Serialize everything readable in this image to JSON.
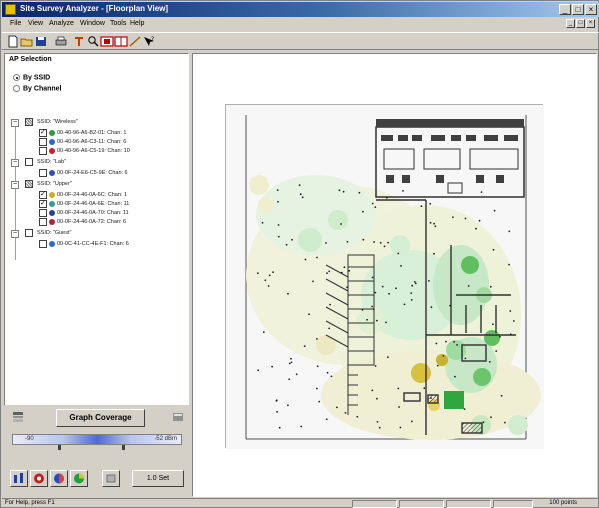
{
  "window": {
    "title": "Site Survey Analyzer - [Floorplan View]",
    "buttons": [
      "_",
      "□",
      "×"
    ]
  },
  "menu": [
    "File",
    "View",
    "Analyze",
    "Window",
    "Tools",
    "Help"
  ],
  "toolbar": [
    "new-icon",
    "open-icon",
    "save-icon",
    "print-icon",
    "filter-icon",
    "zoom-icon",
    "ap-icon",
    "grid-icon",
    "measure-icon",
    "help-icon"
  ],
  "left_panel": {
    "title": "AP Selection",
    "radio_ssid": "By SSID",
    "radio_channel": "By Channel",
    "groups": [
      {
        "ssid": "SSID: \"Wireless\"",
        "aps": [
          {
            "label": "00-40-96-A6-B2-01: Chan: 1",
            "color": "#2d9c3c"
          },
          {
            "label": "00-40-96-A6-C3-11: Chan: 6",
            "color": "#2a6ad0"
          },
          {
            "label": "00-40-96-A6-C5-19: Chan: 10",
            "color": "#c4202a"
          }
        ]
      },
      {
        "ssid": "SSID: \"Lab\"",
        "aps": [
          {
            "label": "00-0F-24-E6-C5-9E: Chan: 6",
            "color": "#3050b8"
          }
        ]
      },
      {
        "ssid": "SSID: \"Upper\"",
        "aps": [
          {
            "label": "00-0F-24-46-0A-6C: Chan: 1",
            "color": "#c8b020"
          },
          {
            "label": "00-0F-24-46-0A-6E: Chan: 11",
            "color": "#2f9e9a"
          },
          {
            "label": "00-0F-24-46-0A-70: Chan: 11",
            "color": "#2a3f9c"
          },
          {
            "label": "00-0F-24-46-0A-72: Chan: 6",
            "color": "#b0243a"
          }
        ]
      },
      {
        "ssid": "SSID: \"Guest\"",
        "aps": [
          {
            "label": "00-0C-41-CC-4E-F1: Chan: 6",
            "color": "#2a6ad0"
          }
        ]
      }
    ],
    "graph_button": "Graph Coverage",
    "signal_min": "-90",
    "signal_max": "-52 dBm",
    "set_button": "1.0 Set"
  },
  "status": {
    "left": "For Help, press F1",
    "right": "100 points"
  }
}
